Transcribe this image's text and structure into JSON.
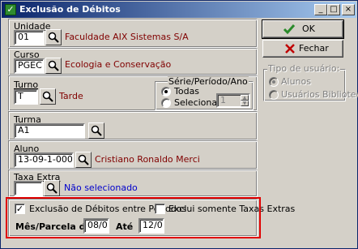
{
  "window": {
    "title": "Exclusão de Débitos"
  },
  "titlebar_buttons": {
    "minimize": "_",
    "maximize": "□",
    "close": "×"
  },
  "unidade": {
    "label": "Unidade",
    "value": "01",
    "description": "Faculdade AIX Sistemas S/A"
  },
  "curso": {
    "label": "Curso",
    "value": "PGEC",
    "description": "Ecologia e Conservação"
  },
  "turno": {
    "label": "Turno",
    "value": "T",
    "description": "Tarde"
  },
  "serie": {
    "label": "Série/Período/Ano",
    "options": [
      {
        "label": "Todas",
        "selected": true
      },
      {
        "label": "Selecionar...",
        "selected": false
      }
    ],
    "value": "1"
  },
  "turma": {
    "label": "Turma",
    "value": "A1"
  },
  "aluno": {
    "label": "Aluno",
    "value": "13-09-1-00001",
    "description": "Cristiano Ronaldo Merci"
  },
  "taxa": {
    "label": "Taxa Extra",
    "value": "",
    "description": "Não selecionado"
  },
  "options": {
    "exclusao_label": "Exclusão de Débitos entre Períodos",
    "exclusao_checked": true,
    "somente_taxas_label": "Exclui somente Taxas Extras",
    "somente_taxas_checked": false
  },
  "periodo": {
    "from_label": "Mês/Parcela de :",
    "from_value": "08/07",
    "to_label": "Até",
    "to_value": "12/07"
  },
  "buttons": {
    "ok": "OK",
    "fechar": "Fechar"
  },
  "tipo_usuario": {
    "label": "Tipo de usuário:",
    "options": [
      {
        "label": "Alunos",
        "selected": true
      },
      {
        "label": "Usuários Biblioteca",
        "selected": false
      }
    ]
  },
  "colors": {
    "titlebar": "#0a246a",
    "accent_red": "#e00000",
    "desc_text": "#800000",
    "link_blue": "#0000cc"
  }
}
